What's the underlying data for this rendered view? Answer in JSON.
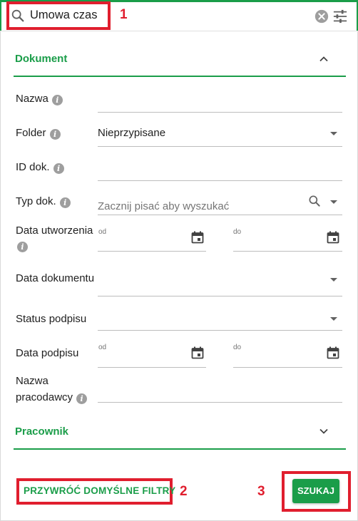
{
  "search": {
    "query": "Umowa czas"
  },
  "annotations": [
    "1",
    "2",
    "3"
  ],
  "sections": {
    "document": {
      "title": "Dokument",
      "expanded": true
    },
    "employee": {
      "title": "Pracownik",
      "expanded": false
    }
  },
  "fields": {
    "name": {
      "label": "Nazwa",
      "value": ""
    },
    "folder": {
      "label": "Folder",
      "value": "Nieprzypisane"
    },
    "doc_id": {
      "label": "ID dok.",
      "value": ""
    },
    "doc_type": {
      "label": "Typ dok.",
      "placeholder": "Zacznij pisać aby wyszukać"
    },
    "created_date": {
      "label": "Data utworzenia",
      "from": "od",
      "to": "do"
    },
    "document_date": {
      "label": "Data dokumentu",
      "value": ""
    },
    "signature_status": {
      "label": "Status podpisu",
      "value": ""
    },
    "signature_date": {
      "label": "Data podpisu",
      "from": "od",
      "to": "do"
    },
    "employer_name": {
      "label_line1": "Nazwa",
      "label_line2": "pracodawcy",
      "value": ""
    }
  },
  "footer": {
    "restore_label": "PRZYWRÓĆ DOMYŚLNE FILTRY",
    "search_label": "SZUKAJ"
  },
  "colors": {
    "accent": "#1a9d49",
    "annotation": "#e01e2e"
  },
  "icons": {
    "search": "search-icon",
    "clear": "clear-icon",
    "tune": "tune-icon",
    "info": "info-icon",
    "calendar": "calendar-icon"
  }
}
